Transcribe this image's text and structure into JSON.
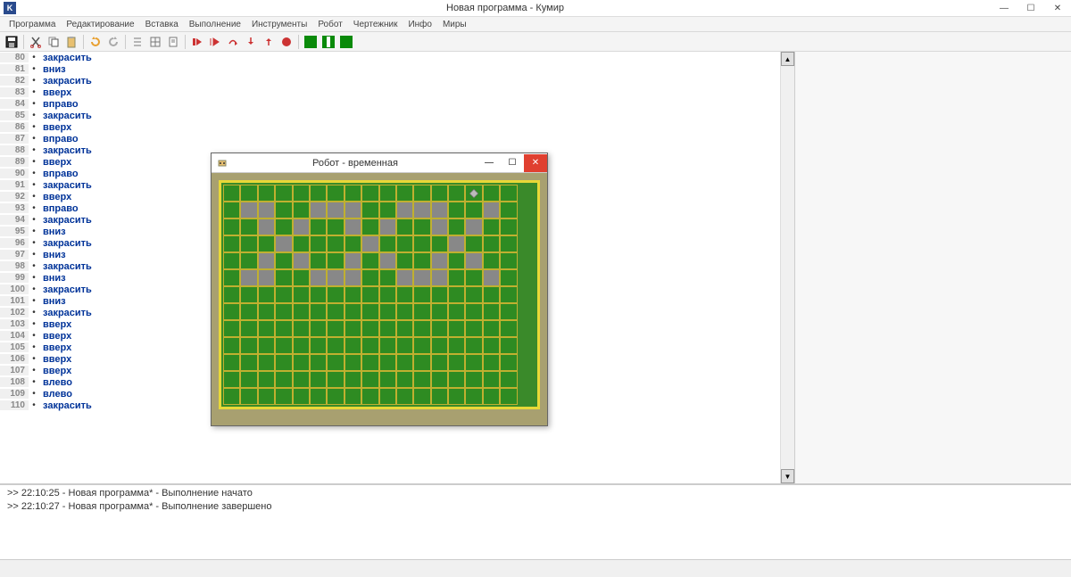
{
  "window": {
    "title": "Новая программа - Кумир",
    "app_letter": "K"
  },
  "menu": [
    "Программа",
    "Редактирование",
    "Вставка",
    "Выполнение",
    "Инструменты",
    "Робот",
    "Чертежник",
    "Инфо",
    "Миры"
  ],
  "code": [
    {
      "n": 80,
      "t": "закрасить"
    },
    {
      "n": 81,
      "t": "вниз"
    },
    {
      "n": 82,
      "t": "закрасить"
    },
    {
      "n": 83,
      "t": "вверх"
    },
    {
      "n": 84,
      "t": "вправо"
    },
    {
      "n": 85,
      "t": "закрасить"
    },
    {
      "n": 86,
      "t": "вверх"
    },
    {
      "n": 87,
      "t": "вправо"
    },
    {
      "n": 88,
      "t": "закрасить"
    },
    {
      "n": 89,
      "t": "вверх"
    },
    {
      "n": 90,
      "t": "вправо"
    },
    {
      "n": 91,
      "t": "закрасить"
    },
    {
      "n": 92,
      "t": "вверх"
    },
    {
      "n": 93,
      "t": "вправо"
    },
    {
      "n": 94,
      "t": "закрасить"
    },
    {
      "n": 95,
      "t": "вниз"
    },
    {
      "n": 96,
      "t": "закрасить"
    },
    {
      "n": 97,
      "t": "вниз"
    },
    {
      "n": 98,
      "t": "закрасить"
    },
    {
      "n": 99,
      "t": "вниз"
    },
    {
      "n": 100,
      "t": "закрасить"
    },
    {
      "n": 101,
      "t": "вниз"
    },
    {
      "n": 102,
      "t": "закрасить"
    },
    {
      "n": 103,
      "t": "вверх"
    },
    {
      "n": 104,
      "t": "вверх"
    },
    {
      "n": 105,
      "t": "вверх"
    },
    {
      "n": 106,
      "t": "вверх"
    },
    {
      "n": 107,
      "t": "вверх"
    },
    {
      "n": 108,
      "t": "влево"
    },
    {
      "n": 109,
      "t": "влево"
    },
    {
      "n": 110,
      "t": "закрасить"
    }
  ],
  "console": [
    ">> 22:10:25 - Новая программа* - Выполнение начато",
    ">> 22:10:27 - Новая программа* - Выполнение завершено"
  ],
  "robot": {
    "title": "Робот - временная",
    "cols": 17,
    "rows": 13,
    "robot_pos": [
      14,
      0
    ],
    "painted": [
      [
        1,
        1
      ],
      [
        1,
        5
      ],
      [
        2,
        1
      ],
      [
        2,
        2
      ],
      [
        2,
        4
      ],
      [
        2,
        5
      ],
      [
        3,
        3
      ],
      [
        4,
        2
      ],
      [
        4,
        4
      ],
      [
        5,
        1
      ],
      [
        5,
        5
      ],
      [
        6,
        1
      ],
      [
        6,
        5
      ],
      [
        7,
        1
      ],
      [
        7,
        2
      ],
      [
        7,
        4
      ],
      [
        7,
        5
      ],
      [
        8,
        3
      ],
      [
        9,
        2
      ],
      [
        9,
        4
      ],
      [
        10,
        1
      ],
      [
        10,
        5
      ],
      [
        11,
        1
      ],
      [
        11,
        5
      ],
      [
        12,
        1
      ],
      [
        12,
        2
      ],
      [
        12,
        4
      ],
      [
        12,
        5
      ],
      [
        13,
        3
      ],
      [
        14,
        2
      ],
      [
        14,
        4
      ],
      [
        15,
        1
      ],
      [
        15,
        5
      ]
    ]
  },
  "colors": {
    "keyword": "#003399",
    "gutter": "#f0f0f0"
  }
}
